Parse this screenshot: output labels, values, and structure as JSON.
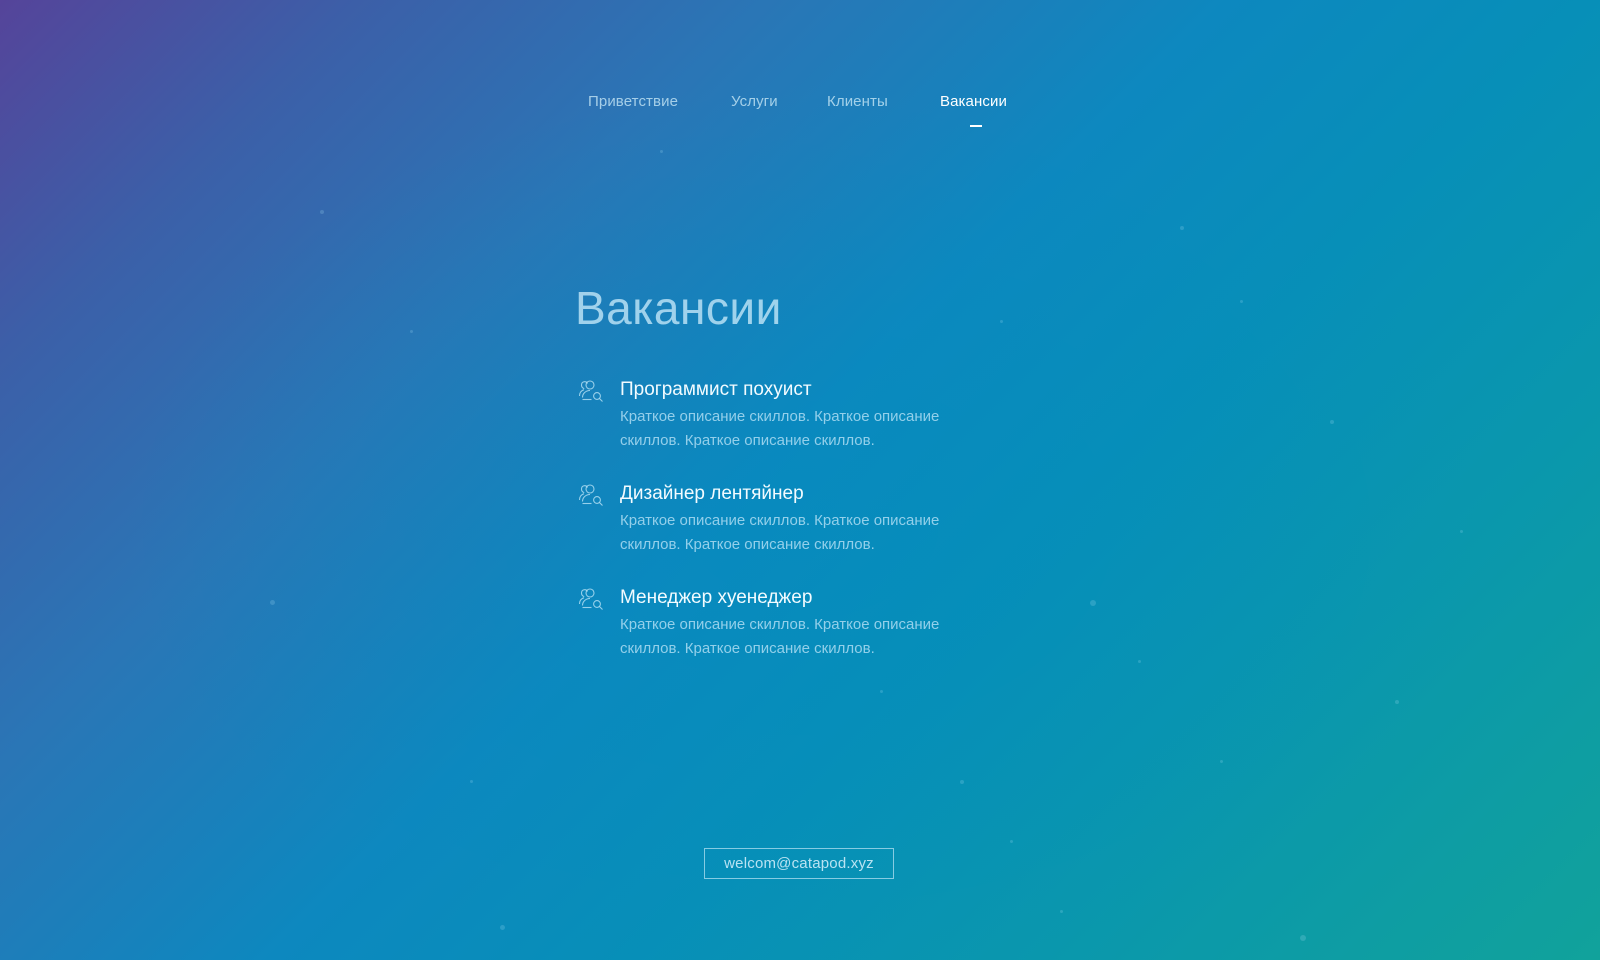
{
  "theme": {
    "accent": "#ffffff",
    "background_start": "#55449a",
    "background_end": "#11a29b"
  },
  "nav": {
    "items": [
      {
        "label": "Приветствие",
        "active": false
      },
      {
        "label": "Услуги",
        "active": false
      },
      {
        "label": "Клиенты",
        "active": false
      },
      {
        "label": "Вакансии",
        "active": true
      }
    ]
  },
  "section": {
    "title": "Вакансии",
    "vacancies": [
      {
        "icon": "users-search-icon",
        "title": "Программист похуист",
        "description": "Краткое описание скиллов. Краткое описание скиллов. Краткое описание скиллов."
      },
      {
        "icon": "users-search-icon",
        "title": "Дизайнер лентяйнер",
        "description": "Краткое описание скиллов. Краткое описание скиллов. Краткое описание скиллов."
      },
      {
        "icon": "users-search-icon",
        "title": "Менеджер хуенеджер",
        "description": "Краткое описание скиллов. Краткое описание скиллов. Краткое описание скиллов."
      }
    ]
  },
  "footer": {
    "email": "welcom@catapod.xyz"
  }
}
